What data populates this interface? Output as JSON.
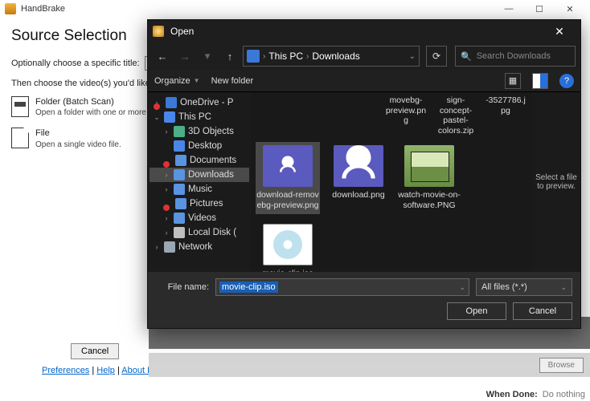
{
  "handbrake": {
    "title": "HandBrake",
    "sys": {
      "min": "—",
      "max": "☐",
      "close": "✕"
    },
    "heading": "Source Selection",
    "opt_label": "Optionally choose a specific title:",
    "instr": "Then choose the video(s) you'd like to encode:",
    "folder_title": "Folder (Batch Scan)",
    "folder_desc": "Open a folder with one or more files.",
    "file_title": "File",
    "file_desc": "Open a single video file.",
    "cancel": "Cancel",
    "links": {
      "prefs": "Preferences",
      "help": "Help",
      "about": "About HandBrake"
    },
    "browse": "Browse",
    "when_done_label": "When Done:",
    "when_done_value": "Do nothing"
  },
  "open": {
    "title": "Open",
    "close_glyph": "✕",
    "nav": {
      "back": "←",
      "fwd": "→",
      "drop": "▾",
      "up": "↑",
      "refresh": "⟳"
    },
    "breadcrumb": {
      "sep": "›",
      "items": [
        "This PC",
        "Downloads"
      ],
      "end_drop": "⌄"
    },
    "search_icon": "🔍",
    "search_placeholder": "Search Downloads",
    "toolbar": {
      "organize": "Organize",
      "newfolder": "New folder",
      "help": "?"
    },
    "tree": [
      {
        "exp": "›",
        "icon": "cloud",
        "label": "OneDrive - P",
        "badge": true
      },
      {
        "exp": "⌄",
        "icon": "pc",
        "label": "This PC"
      },
      {
        "exp": "›",
        "icon": "obj",
        "label": "3D Objects",
        "indent": 1
      },
      {
        "exp": "",
        "icon": "desk",
        "label": "Desktop",
        "indent": 1
      },
      {
        "exp": "",
        "icon": "doc",
        "label": "Documents",
        "indent": 1,
        "badge": true
      },
      {
        "exp": "›",
        "icon": "dl",
        "label": "Downloads",
        "indent": 1,
        "sel": true
      },
      {
        "exp": "›",
        "icon": "music",
        "label": "Music",
        "indent": 1
      },
      {
        "exp": "",
        "icon": "pic",
        "label": "Pictures",
        "indent": 1,
        "badge": true
      },
      {
        "exp": "›",
        "icon": "vid",
        "label": "Videos",
        "indent": 1
      },
      {
        "exp": "›",
        "icon": "disk",
        "label": "Local Disk (",
        "indent": 1
      },
      {
        "exp": "›",
        "icon": "net",
        "label": "Network"
      }
    ],
    "top_row": [
      "movebg-preview.png",
      "sign-concept-pastel-colors.zip",
      "-3527786.jpg"
    ],
    "files": [
      {
        "name": "download-removebg-preview.png",
        "thumb": "pdf",
        "sel": true
      },
      {
        "name": "download.png",
        "thumb": "png"
      },
      {
        "name": "watch-movie-on-software.PNG",
        "thumb": "photo"
      },
      {
        "name": "movie-clip.iso",
        "thumb": "iso"
      }
    ],
    "preview_text": "Select a file to preview.",
    "file_label": "File name:",
    "file_value": "movie-clip.iso",
    "filter": "All files (*.*)",
    "open_btn": "Open",
    "cancel_btn": "Cancel"
  }
}
